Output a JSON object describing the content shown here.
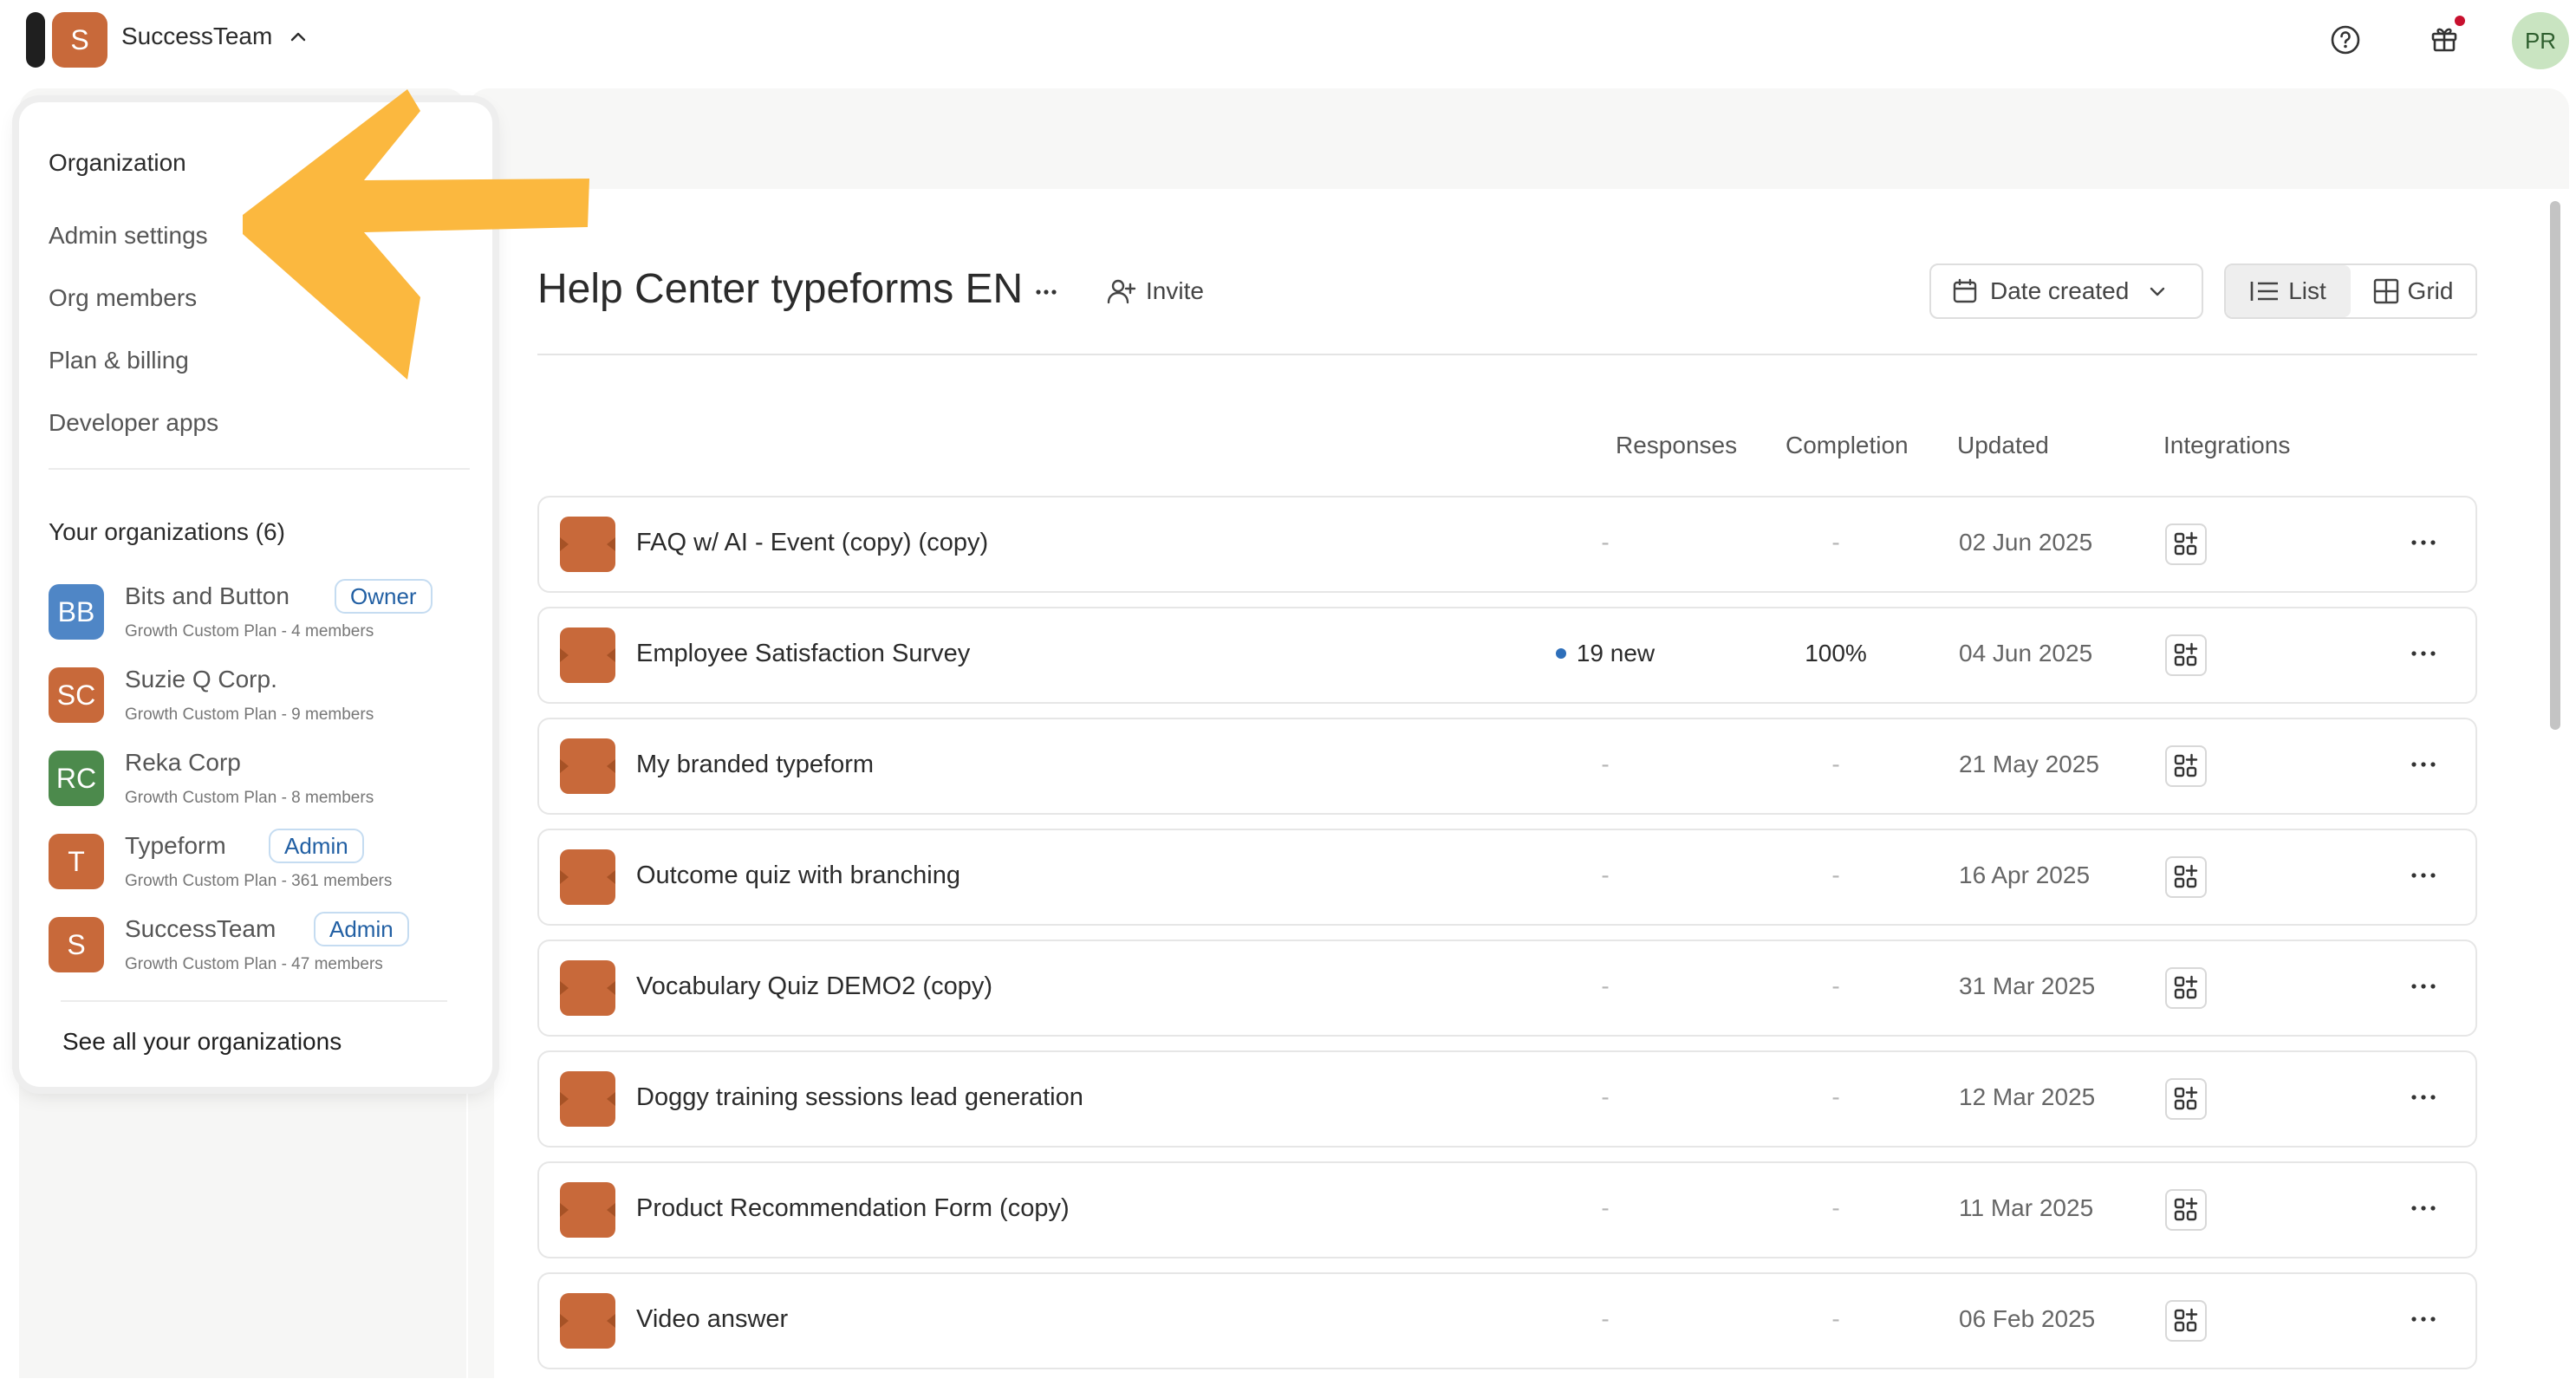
{
  "topbar": {
    "org_initial": "S",
    "org_name": "SuccessTeam",
    "user_initials": "PR"
  },
  "menu": {
    "organization_heading": "Organization",
    "items": [
      {
        "label": "Admin settings"
      },
      {
        "label": "Org members"
      },
      {
        "label": "Plan & billing"
      },
      {
        "label": "Developer apps"
      }
    ],
    "your_orgs_heading": "Your organizations (6)",
    "orgs": [
      {
        "initials": "BB",
        "name": "Bits and Button",
        "role": "Owner",
        "plan": "Growth Custom Plan - 4 members",
        "color": "#4f86c6"
      },
      {
        "initials": "SC",
        "name": "Suzie Q Corp.",
        "role": "",
        "plan": "Growth Custom Plan - 9 members",
        "color": "#c8693a"
      },
      {
        "initials": "RC",
        "name": "Reka Corp",
        "role": "",
        "plan": "Growth Custom Plan - 8 members",
        "color": "#4c8a4c"
      },
      {
        "initials": "T",
        "name": "Typeform",
        "role": "Admin",
        "plan": "Growth Custom Plan - 361 members",
        "color": "#c8693a"
      },
      {
        "initials": "S",
        "name": "SuccessTeam",
        "role": "Admin",
        "plan": "Growth Custom Plan - 47 members",
        "color": "#c8693a"
      }
    ],
    "see_all": "See all your organizations"
  },
  "workspace": {
    "title": "Help Center typeforms EN",
    "invite_label": "Invite",
    "sort_label": "Date created",
    "view_list": "List",
    "view_grid": "Grid",
    "columns": {
      "responses": "Responses",
      "completion": "Completion",
      "updated": "Updated",
      "integrations": "Integrations"
    }
  },
  "forms": [
    {
      "title": "FAQ w/ AI - Event (copy) (copy)",
      "responses": "-",
      "completion": "-",
      "updated": "02 Jun 2025"
    },
    {
      "title": "Employee Satisfaction Survey",
      "responses": "19 new",
      "completion": "100%",
      "updated": "04 Jun 2025"
    },
    {
      "title": "My branded typeform",
      "responses": "-",
      "completion": "-",
      "updated": "21 May 2025"
    },
    {
      "title": "Outcome quiz with branching",
      "responses": "-",
      "completion": "-",
      "updated": "16 Apr 2025"
    },
    {
      "title": "Vocabulary Quiz DEMO2 (copy)",
      "responses": "-",
      "completion": "-",
      "updated": "31 Mar 2025"
    },
    {
      "title": "Doggy training sessions lead generation",
      "responses": "-",
      "completion": "-",
      "updated": "12 Mar 2025"
    },
    {
      "title": "Product Recommendation Form (copy)",
      "responses": "-",
      "completion": "-",
      "updated": "11 Mar 2025"
    },
    {
      "title": "Video answer",
      "responses": "-",
      "completion": "-",
      "updated": "06 Feb 2025"
    }
  ],
  "colors": {
    "accent_orange": "#c8693a",
    "annotation_arrow": "#fbb83f",
    "badge_blue": "#215fa3",
    "new_dot": "#2e6fba"
  }
}
